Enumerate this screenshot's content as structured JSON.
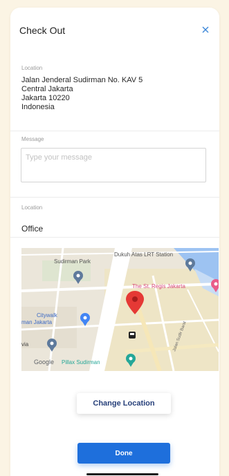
{
  "header": {
    "title": "Check Out",
    "close_icon": "close-icon"
  },
  "address_section": {
    "label": "Location",
    "lines": [
      "Jalan Jenderal Sudirman No. KAV 5",
      "Central Jakarta",
      "Jakarta 10220",
      "Indonesia"
    ]
  },
  "message_section": {
    "label": "Message",
    "placeholder": "Type your message",
    "value": ""
  },
  "location_section": {
    "label": "Location",
    "value": "Office"
  },
  "map": {
    "labels": {
      "top": "Dukuh Atas LRT Station",
      "park": "Sudirman Park",
      "hotel": "The St. Regis Jakarta",
      "citywalk_1": "Citywalk",
      "citywalk_2": "man Jakarta",
      "via": "via",
      "street": "Jalan Sudir Barat",
      "pillar": "Pillax Sudirman",
      "google": "Google"
    },
    "colors": {
      "marker": "#e53935",
      "water": "#9dc3f2",
      "road": "#ffffff",
      "pin": "#5e7a9c",
      "pink_pin": "#e95c8a",
      "blue_pin": "#4285f4",
      "teal_pin": "#25a798"
    }
  },
  "actions": {
    "change_location": "Change Location",
    "done": "Done"
  },
  "colors": {
    "page_background": "#fbf4e4",
    "primary": "#1e6fdc",
    "change_text": "#27407a"
  }
}
